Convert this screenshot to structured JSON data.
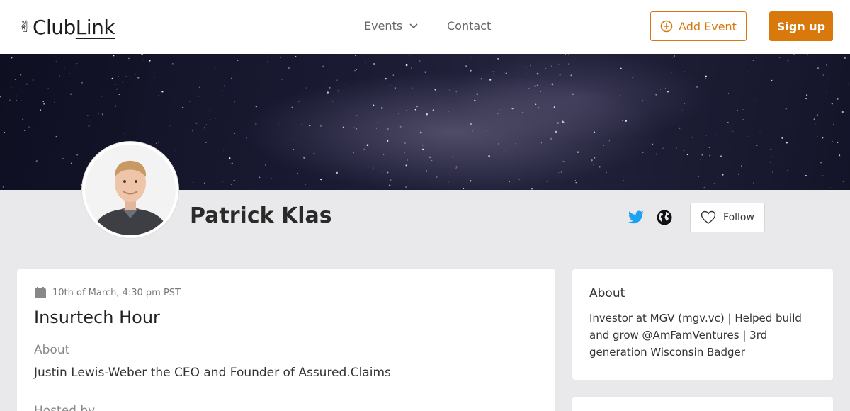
{
  "header": {
    "logo_prefix": "Club",
    "logo_suffix": "Link",
    "nav_events": "Events",
    "nav_contact": "Contact",
    "add_event_label": "Add Event",
    "signup_label": "Sign up"
  },
  "profile": {
    "name": "Patrick Klas",
    "follow_label": "Follow"
  },
  "event": {
    "date": "10th of March, 4:30 pm PST",
    "title": "Insurtech Hour",
    "about_label": "About",
    "description": "Justin Lewis-Weber the CEO and Founder of Assured.Claims",
    "hosted_label": "Hosted by"
  },
  "about": {
    "title": "About",
    "text": "Investor at MGV (mgv.vc) | Helped build and grow @AmFamVentures | 3rd generation Wisconsin Badger"
  },
  "colors": {
    "accent": "#d9780b",
    "twitter": "#1da1f2",
    "page_bg": "#e9e9ec"
  }
}
